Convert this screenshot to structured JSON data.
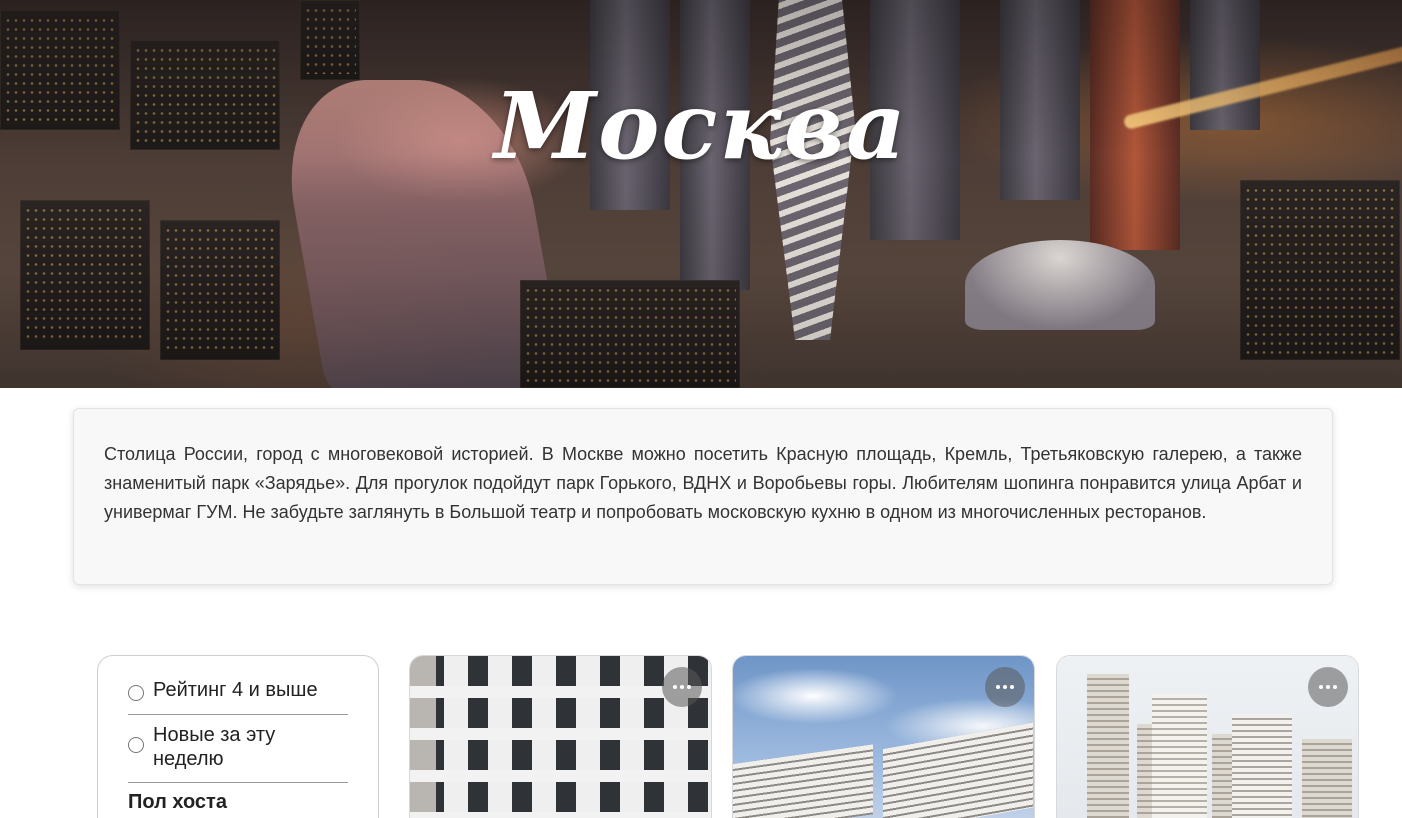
{
  "hero": {
    "city_title": "Москва"
  },
  "description": {
    "text": "Столица России, город с многовековой историей. В Москве можно посетить Красную площадь, Кремль, Третьяковскую галерею, а также знаменитый парк «Зарядье». Для прогулок подойдут парк Горького, ВДНХ и Воробьевы горы. Любителям шопинга понравится улица Арбат и универмаг ГУМ. Не забудьте заглянуть в Большой театр и попробовать московскую кухню в одном из многочисленных ресторанов."
  },
  "filters": {
    "rating_label": "Рейтинг 4 и выше",
    "new_label": "Новые за эту неделю",
    "host_gender_title": "Пол хоста"
  },
  "cards": [
    {
      "more_icon": "ellipsis-icon"
    },
    {
      "more_icon": "ellipsis-icon"
    },
    {
      "more_icon": "ellipsis-icon"
    }
  ]
}
